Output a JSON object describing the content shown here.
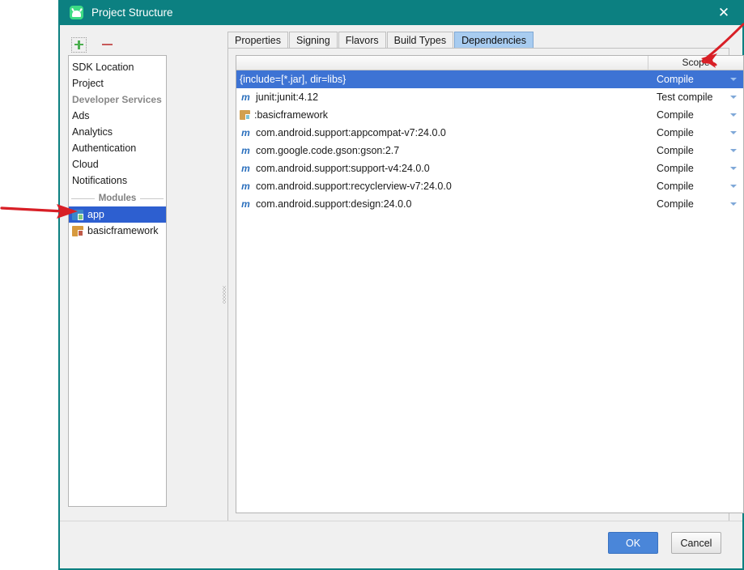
{
  "window": {
    "title": "Project Structure",
    "app_icon": "android-studio-icon",
    "close_icon": "close-icon"
  },
  "left_toolbar": {
    "add_icon": "plus-icon",
    "remove_icon": "minus-icon"
  },
  "sidebar": {
    "items": [
      {
        "label": "SDK Location",
        "type": "item",
        "selected": false
      },
      {
        "label": "Project",
        "type": "item",
        "selected": false
      },
      {
        "label": "Developer Services",
        "type": "group",
        "selected": false
      },
      {
        "label": "Ads",
        "type": "item",
        "selected": false
      },
      {
        "label": "Analytics",
        "type": "item",
        "selected": false
      },
      {
        "label": "Authentication",
        "type": "item",
        "selected": false
      },
      {
        "label": "Cloud",
        "type": "item",
        "selected": false
      },
      {
        "label": "Notifications",
        "type": "item",
        "selected": false
      }
    ],
    "modules_separator": "Modules",
    "modules": [
      {
        "label": "app",
        "icon": "app-module-icon",
        "selected": true
      },
      {
        "label": "basicframework",
        "icon": "library-module-icon",
        "selected": false
      }
    ]
  },
  "tabs": [
    {
      "label": "Properties",
      "active": false
    },
    {
      "label": "Signing",
      "active": false
    },
    {
      "label": "Flavors",
      "active": false
    },
    {
      "label": "Build Types",
      "active": false
    },
    {
      "label": "Dependencies",
      "active": true
    }
  ],
  "table": {
    "headers": {
      "name": "",
      "scope": "Scope"
    },
    "rows": [
      {
        "name": "{include=[*.jar], dir=libs}",
        "scope": "Compile",
        "icon": "file-dependency",
        "selected": true
      },
      {
        "name": "junit:junit:4.12",
        "scope": "Test compile",
        "icon": "maven-icon",
        "selected": false
      },
      {
        "name": ":basicframework",
        "scope": "Compile",
        "icon": "module-icon",
        "selected": false
      },
      {
        "name": "com.android.support:appcompat-v7:24.0.0",
        "scope": "Compile",
        "icon": "maven-icon",
        "selected": false
      },
      {
        "name": "com.google.code.gson:gson:2.7",
        "scope": "Compile",
        "icon": "maven-icon",
        "selected": false
      },
      {
        "name": "com.android.support:support-v4:24.0.0",
        "scope": "Compile",
        "icon": "maven-icon",
        "selected": false
      },
      {
        "name": "com.android.support:recyclerview-v7:24.0.0",
        "scope": "Compile",
        "icon": "maven-icon",
        "selected": false
      },
      {
        "name": "com.android.support:design:24.0.0",
        "scope": "Compile",
        "icon": "maven-icon",
        "selected": false
      }
    ]
  },
  "right_tools": [
    {
      "name": "add-dependency-button",
      "icon": "plus-icon"
    },
    {
      "name": "remove-dependency-button",
      "icon": "minus-icon"
    },
    {
      "name": "move-up-button",
      "icon": "arrow-up-icon"
    },
    {
      "name": "move-down-button",
      "icon": "arrow-down-icon"
    }
  ],
  "footer": {
    "ok_label": "OK",
    "cancel_label": "Cancel"
  },
  "annotations": {
    "arrow_color": "#d81f26",
    "left_arrow_target": "app",
    "right_arrow_target": "add-dependency-button"
  },
  "colors": {
    "titlebar": "#0c8081",
    "selection": "#3d73d4",
    "sidebar_selection": "#2d5fd0",
    "active_tab": "#a8ccf0",
    "ok_button": "#4a86d9",
    "plus_green": "#4caf50",
    "minus_red": "#c75a5a"
  }
}
